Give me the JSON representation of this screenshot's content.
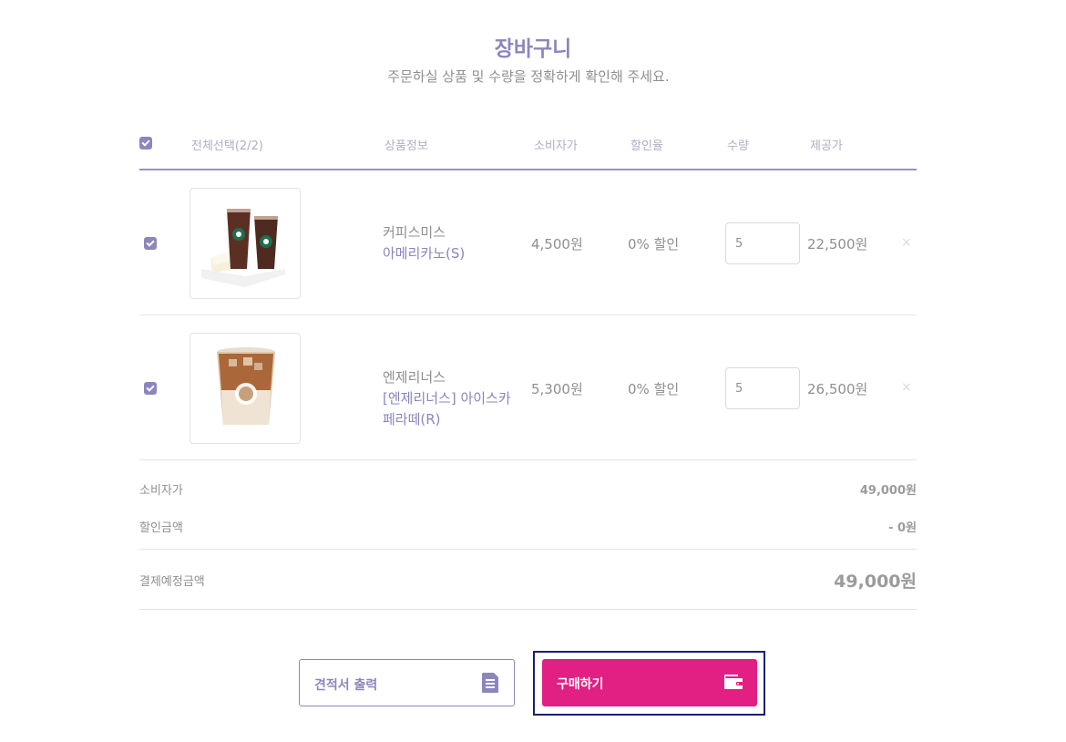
{
  "page": {
    "title": "장바구니",
    "subtitle": "주문하실 상품 및 수량을 정확하게 확인해 주세요."
  },
  "table_header": {
    "select_all": "전체선택(2/2)",
    "product_info": "상품정보",
    "list_price": "소비자가",
    "discount_rate": "할인율",
    "quantity": "수량",
    "offer_price": "제공가"
  },
  "items": [
    {
      "brand": "커피스미스",
      "name": "아메리카노(S)",
      "price": "4,500원",
      "discount": "0% 할인",
      "quantity": "5",
      "total": "22,500원",
      "remove": "×",
      "checked": true,
      "image_icon": "americano-cheesecake-image"
    },
    {
      "brand": "엔제리너스",
      "name": "[엔제리너스] 아이스카페라떼(R)",
      "price": "5,300원",
      "discount": "0% 할인",
      "quantity": "5",
      "total": "26,500원",
      "remove": "×",
      "checked": true,
      "image_icon": "iced-latte-image"
    }
  ],
  "summary": {
    "list_price_label": "소비자가",
    "list_price_value": "49,000원",
    "discount_label": "할인금액",
    "discount_value": "- 0원",
    "payment_label": "결제예정금액",
    "payment_value": "49,000원"
  },
  "buttons": {
    "quote_label": "견적서 출력",
    "quote_icon": "document-icon",
    "buy_label": "구매하기",
    "buy_icon": "wallet-icon"
  },
  "colors": {
    "accent": "#8b87bd",
    "buy": "#e21f83",
    "focus_outline": "#1c1f6e"
  }
}
